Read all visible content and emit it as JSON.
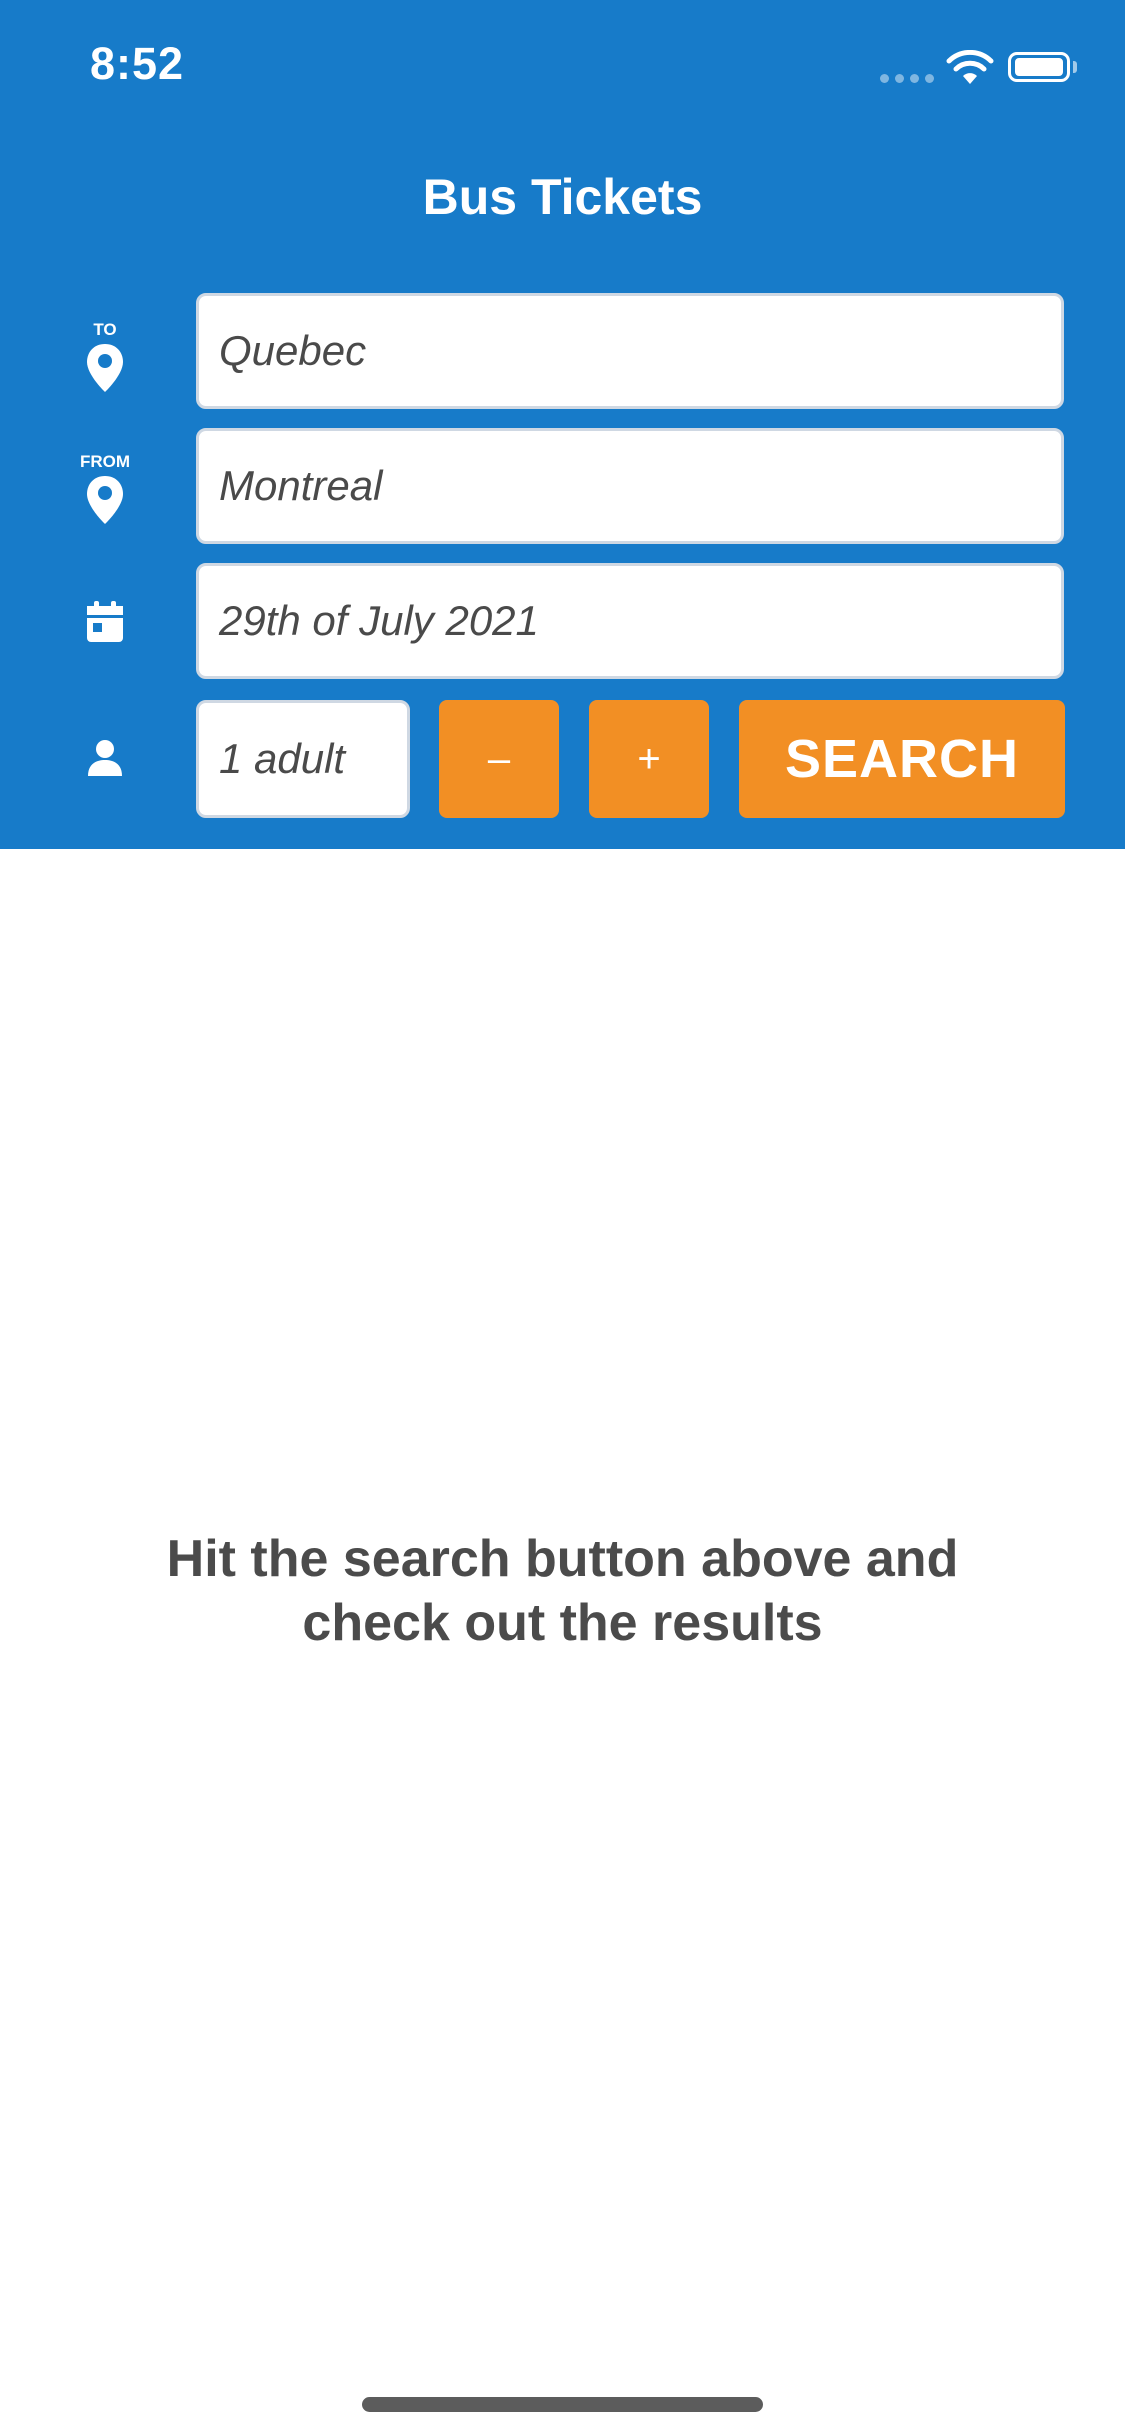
{
  "status_bar": {
    "time": "8:52"
  },
  "header": {
    "title": "Bus Tickets"
  },
  "form": {
    "to_label": "TO",
    "to_value": "Quebec",
    "from_label": "FROM",
    "from_value": "Montreal",
    "date_value": "29th of July 2021",
    "passengers_value": "1 adult",
    "decrement_label": "–",
    "increment_label": "+",
    "search_label": "SEARCH"
  },
  "main": {
    "hint_line1": "Hit the search button above and",
    "hint_line2": "check out the results"
  },
  "colors": {
    "header_bg": "#177bc9",
    "accent": "#f28f24"
  },
  "icons": [
    "location-pin-icon",
    "calendar-icon",
    "person-icon",
    "wifi-icon",
    "battery-icon"
  ]
}
